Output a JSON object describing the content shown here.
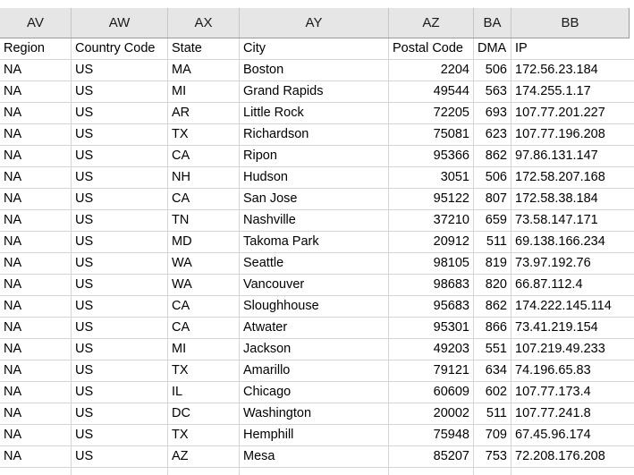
{
  "spreadsheet": {
    "column_letters": [
      "AV",
      "AW",
      "AX",
      "AY",
      "AZ",
      "BA",
      "BB"
    ],
    "field_headers": {
      "region": "Region",
      "country_code": "Country Code",
      "state": "State",
      "city": "City",
      "postal_code": "Postal Code",
      "dma": "DMA",
      "ip": "IP"
    },
    "rows": [
      {
        "region": "NA",
        "country_code": "US",
        "state": "MA",
        "city": "Boston",
        "postal_code": "2204",
        "dma": "506",
        "ip": "172.56.23.184"
      },
      {
        "region": "NA",
        "country_code": "US",
        "state": "MI",
        "city": "Grand Rapids",
        "postal_code": "49544",
        "dma": "563",
        "ip": "174.255.1.17"
      },
      {
        "region": "NA",
        "country_code": "US",
        "state": "AR",
        "city": "Little Rock",
        "postal_code": "72205",
        "dma": "693",
        "ip": "107.77.201.227"
      },
      {
        "region": "NA",
        "country_code": "US",
        "state": "TX",
        "city": "Richardson",
        "postal_code": "75081",
        "dma": "623",
        "ip": "107.77.196.208"
      },
      {
        "region": "NA",
        "country_code": "US",
        "state": "CA",
        "city": "Ripon",
        "postal_code": "95366",
        "dma": "862",
        "ip": "97.86.131.147"
      },
      {
        "region": "NA",
        "country_code": "US",
        "state": "NH",
        "city": "Hudson",
        "postal_code": "3051",
        "dma": "506",
        "ip": "172.58.207.168"
      },
      {
        "region": "NA",
        "country_code": "US",
        "state": "CA",
        "city": "San Jose",
        "postal_code": "95122",
        "dma": "807",
        "ip": "172.58.38.184"
      },
      {
        "region": "NA",
        "country_code": "US",
        "state": "TN",
        "city": "Nashville",
        "postal_code": "37210",
        "dma": "659",
        "ip": "73.58.147.171"
      },
      {
        "region": "NA",
        "country_code": "US",
        "state": "MD",
        "city": "Takoma Park",
        "postal_code": "20912",
        "dma": "511",
        "ip": "69.138.166.234"
      },
      {
        "region": "NA",
        "country_code": "US",
        "state": "WA",
        "city": "Seattle",
        "postal_code": "98105",
        "dma": "819",
        "ip": "73.97.192.76"
      },
      {
        "region": "NA",
        "country_code": "US",
        "state": "WA",
        "city": "Vancouver",
        "postal_code": "98683",
        "dma": "820",
        "ip": "66.87.112.4"
      },
      {
        "region": "NA",
        "country_code": "US",
        "state": "CA",
        "city": "Sloughhouse",
        "postal_code": "95683",
        "dma": "862",
        "ip": "174.222.145.114"
      },
      {
        "region": "NA",
        "country_code": "US",
        "state": "CA",
        "city": "Atwater",
        "postal_code": "95301",
        "dma": "866",
        "ip": "73.41.219.154"
      },
      {
        "region": "NA",
        "country_code": "US",
        "state": "MI",
        "city": "Jackson",
        "postal_code": "49203",
        "dma": "551",
        "ip": "107.219.49.233"
      },
      {
        "region": "NA",
        "country_code": "US",
        "state": "TX",
        "city": "Amarillo",
        "postal_code": "79121",
        "dma": "634",
        "ip": "74.196.65.83"
      },
      {
        "region": "NA",
        "country_code": "US",
        "state": "IL",
        "city": "Chicago",
        "postal_code": "60609",
        "dma": "602",
        "ip": "107.77.173.4"
      },
      {
        "region": "NA",
        "country_code": "US",
        "state": "DC",
        "city": "Washington",
        "postal_code": "20002",
        "dma": "511",
        "ip": "107.77.241.8"
      },
      {
        "region": "NA",
        "country_code": "US",
        "state": "TX",
        "city": "Hemphill",
        "postal_code": "75948",
        "dma": "709",
        "ip": "67.45.96.174"
      },
      {
        "region": "NA",
        "country_code": "US",
        "state": "AZ",
        "city": "Mesa",
        "postal_code": "85207",
        "dma": "753",
        "ip": "72.208.176.208"
      }
    ],
    "colors": {
      "header_band_background": "#e6e6e6",
      "grid_line": "#d4d4d4",
      "header_divider": "#9a9a9a",
      "cell_text": "#000000",
      "sheet_background": "#ffffff"
    }
  }
}
